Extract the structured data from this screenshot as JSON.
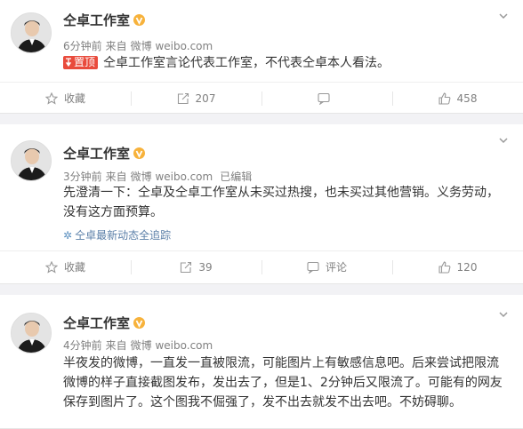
{
  "posts": [
    {
      "author": "仝卓工作室",
      "time": "6分钟前",
      "source_prefix": "来自",
      "source": "微博 weibo.com",
      "pinned_label": "置顶",
      "text": "仝卓工作室言论代表工作室，不代表仝卓本人看法。",
      "actions": {
        "favorite": "收藏",
        "repost": "207",
        "comment": "",
        "like": "458"
      }
    },
    {
      "author": "仝卓工作室",
      "time": "3分钟前",
      "source_prefix": "来自",
      "source": "微博 weibo.com",
      "edited": "已编辑",
      "text": "先澄清一下：仝卓及仝卓工作室从未买过热搜，也未买过其他营销。义务劳动，没有这方面预算。",
      "sublink": "仝卓最新动态全追踪",
      "actions": {
        "favorite": "收藏",
        "repost": "39",
        "comment": "评论",
        "like": "120"
      }
    },
    {
      "author": "仝卓工作室",
      "time": "4分钟前",
      "source_prefix": "来自",
      "source": "微博 weibo.com",
      "text": "半夜发的微博，一直发一直被限流，可能图片上有敏感信息吧。后来尝试把限流微博的样子直接截图发布，发出去了，但是1、2分钟后又限流了。可能有的网友保存到图片了。这个图我不倔强了，发不出去就发不出去吧。不妨碍聊。"
    }
  ],
  "icons": {
    "verified": "orange-v-badge",
    "pin": "pin-icon",
    "favorite": "star-icon",
    "repost": "repost-icon",
    "comment": "comment-icon",
    "like": "thumbs-up-icon",
    "menu": "chevron-down-icon"
  },
  "colors": {
    "pin_badge": "#e94b3c",
    "link": "#5b7fa8",
    "muted": "#808080",
    "badge": "#f7b23b"
  }
}
